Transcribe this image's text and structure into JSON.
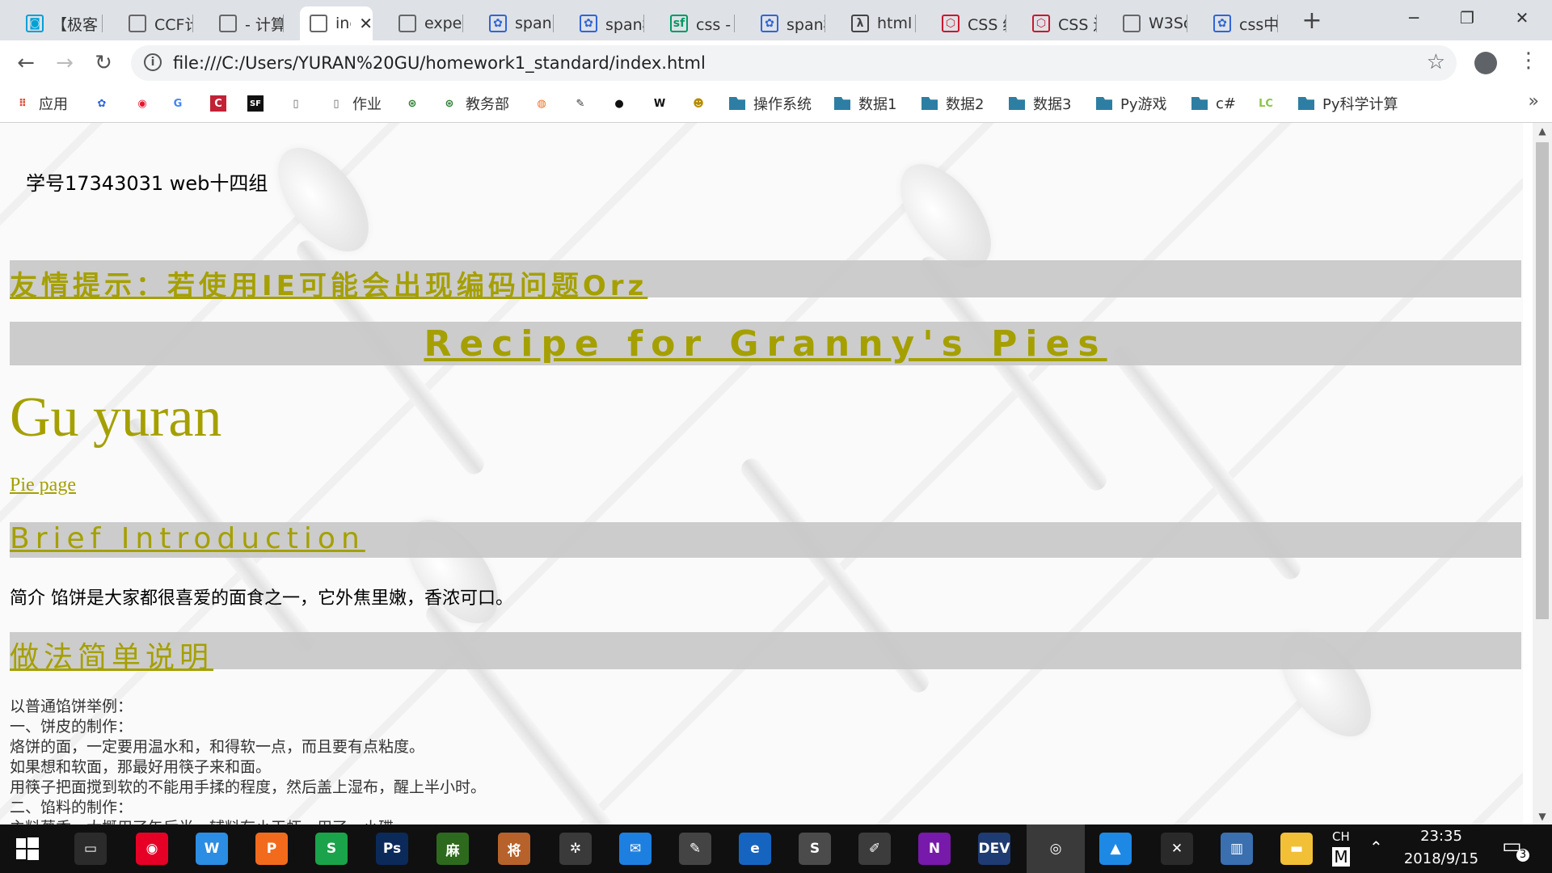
{
  "browser": {
    "tabs": [
      {
        "title": "【极客",
        "icon": "bilibili-icon",
        "color": "#00a1d6"
      },
      {
        "title": "CCF计",
        "icon": "page-icon",
        "color": "#666666"
      },
      {
        "title": "- 计算",
        "icon": "page-icon",
        "color": "#666666"
      },
      {
        "title": "inc",
        "icon": "page-icon",
        "color": "#666666",
        "active": true
      },
      {
        "title": "expec",
        "icon": "page-icon",
        "color": "#666666"
      },
      {
        "title": "span",
        "icon": "baidu-paw-icon",
        "color": "#3065d8"
      },
      {
        "title": "span标",
        "icon": "baidu-paw-icon",
        "color": "#3065d8"
      },
      {
        "title": "css - 打",
        "icon": "segmentfault-icon",
        "color": "#009a61"
      },
      {
        "title": "span标",
        "icon": "baidu-paw-icon",
        "color": "#3065d8"
      },
      {
        "title": "html r",
        "icon": "wolfram-icon",
        "color": "#444444"
      },
      {
        "title": "CSS 绝",
        "icon": "w3cschool-icon",
        "color": "#c7192e"
      },
      {
        "title": "CSS 边",
        "icon": "w3cschool-icon",
        "color": "#c7192e"
      },
      {
        "title": "W3Sc",
        "icon": "page-icon",
        "color": "#666666"
      },
      {
        "title": "css中",
        "icon": "baidu-paw-icon",
        "color": "#3065d8"
      }
    ],
    "url": "file:///C:/Users/YURAN%20GU/homework1_standard/index.html",
    "bookmarks": [
      {
        "label": "应用",
        "icon": "apps-grid-icon"
      },
      {
        "label": "",
        "icon": "baidu-paw-icon"
      },
      {
        "label": "",
        "icon": "weibo-icon"
      },
      {
        "label": "",
        "icon": "translate-icon"
      },
      {
        "label": "",
        "icon": "csdn-icon"
      },
      {
        "label": "",
        "icon": "sf-icon"
      },
      {
        "label": "",
        "icon": "page-icon"
      },
      {
        "label": "作业",
        "icon": "page-icon"
      },
      {
        "label": "",
        "icon": "emblem-icon"
      },
      {
        "label": "教务部",
        "icon": "emblem-icon"
      },
      {
        "label": "",
        "icon": "orange-app-icon"
      },
      {
        "label": "",
        "icon": "pen-icon"
      },
      {
        "label": "",
        "icon": "github-icon"
      },
      {
        "label": "",
        "icon": "wikipedia-icon"
      },
      {
        "label": "",
        "icon": "smiley-icon"
      },
      {
        "label": "操作系统",
        "icon": "folder-icon"
      },
      {
        "label": "数据1",
        "icon": "folder-icon"
      },
      {
        "label": "数据2",
        "icon": "folder-icon"
      },
      {
        "label": "数据3",
        "icon": "folder-icon"
      },
      {
        "label": "Py游戏",
        "icon": "folder-icon"
      },
      {
        "label": "c#",
        "icon": "folder-icon"
      },
      {
        "label": "",
        "icon": "leetcode-icon"
      },
      {
        "label": "Py科学计算",
        "icon": "folder-icon"
      }
    ]
  },
  "page": {
    "student_no": "学号17343031 web十四组",
    "notice": "友情提示：若使用IE可能会出现编码问题Orz",
    "recipe_title": "Recipe for Granny's Pies",
    "author": "Gu yuran",
    "pie_link": "Pie page",
    "intro_heading": "Brief Introduction",
    "intro_text": "简介 馅饼是大家都很喜爱的面食之一，它外焦里嫩，香浓可口。",
    "method_heading": "做法简单说明",
    "steps": [
      "以普通馅饼举例：",
      "一、饼皮的制作：",
      "烙饼的面，一定要用温水和，和得软一点，而且要有点粘度。",
      "如果想和软面，那最好用筷子来和面。",
      "用筷子把面搅到软的不能用手揉的程度，然后盖上湿布，醒上半小时。",
      "二、馅料的制作：",
      "主料葱香，大概用了午后半，辅料有小干虾，用了一小碟。"
    ]
  },
  "taskbar": {
    "apps": [
      {
        "name": "terminal-icon",
        "color": "#2b2b2b",
        "glyph": "▭"
      },
      {
        "name": "netease-music-icon",
        "color": "#e60026",
        "glyph": "◉"
      },
      {
        "name": "wps-writer-icon",
        "color": "#2b8de3",
        "glyph": "W"
      },
      {
        "name": "wps-presentation-icon",
        "color": "#f26b1d",
        "glyph": "P"
      },
      {
        "name": "wps-spreadsheet-icon",
        "color": "#1aa34a",
        "glyph": "S"
      },
      {
        "name": "photoshop-icon",
        "color": "#0b2a5a",
        "glyph": "Ps"
      },
      {
        "name": "mahjong-game-icon",
        "color": "#2d6a1e",
        "glyph": "麻"
      },
      {
        "name": "chess-game-icon",
        "color": "#b7622b",
        "glyph": "将"
      },
      {
        "name": "tool-icon",
        "color": "#3a3a3a",
        "glyph": "✲"
      },
      {
        "name": "mail-icon",
        "color": "#1d7fe0",
        "glyph": "✉"
      },
      {
        "name": "paint-icon",
        "color": "#444444",
        "glyph": "✎"
      },
      {
        "name": "edge-icon",
        "color": "#1565c0",
        "glyph": "e"
      },
      {
        "name": "sublime-text-icon",
        "color": "#4b4b4b",
        "glyph": "S"
      },
      {
        "name": "notes-icon",
        "color": "#3c3c3c",
        "glyph": "✐"
      },
      {
        "name": "onenote-icon",
        "color": "#7719aa",
        "glyph": "N"
      },
      {
        "name": "devcpp-icon",
        "color": "#1f3b73",
        "glyph": "DEV"
      },
      {
        "name": "chrome-icon",
        "color": "#3a3a3a",
        "glyph": "◎",
        "active": true
      },
      {
        "name": "photos-icon",
        "color": "#1e88e5",
        "glyph": "▲"
      },
      {
        "name": "xshell-icon",
        "color": "#2a2a2a",
        "glyph": "✕"
      },
      {
        "name": "archive-icon",
        "color": "#3a6fb0",
        "glyph": "▥"
      },
      {
        "name": "file-explorer-icon",
        "color": "#f2c037",
        "glyph": "▬"
      }
    ],
    "ime": "CH",
    "ime_mode": "M",
    "time": "23:35",
    "date": "2018/9/15",
    "notifications": "3"
  }
}
